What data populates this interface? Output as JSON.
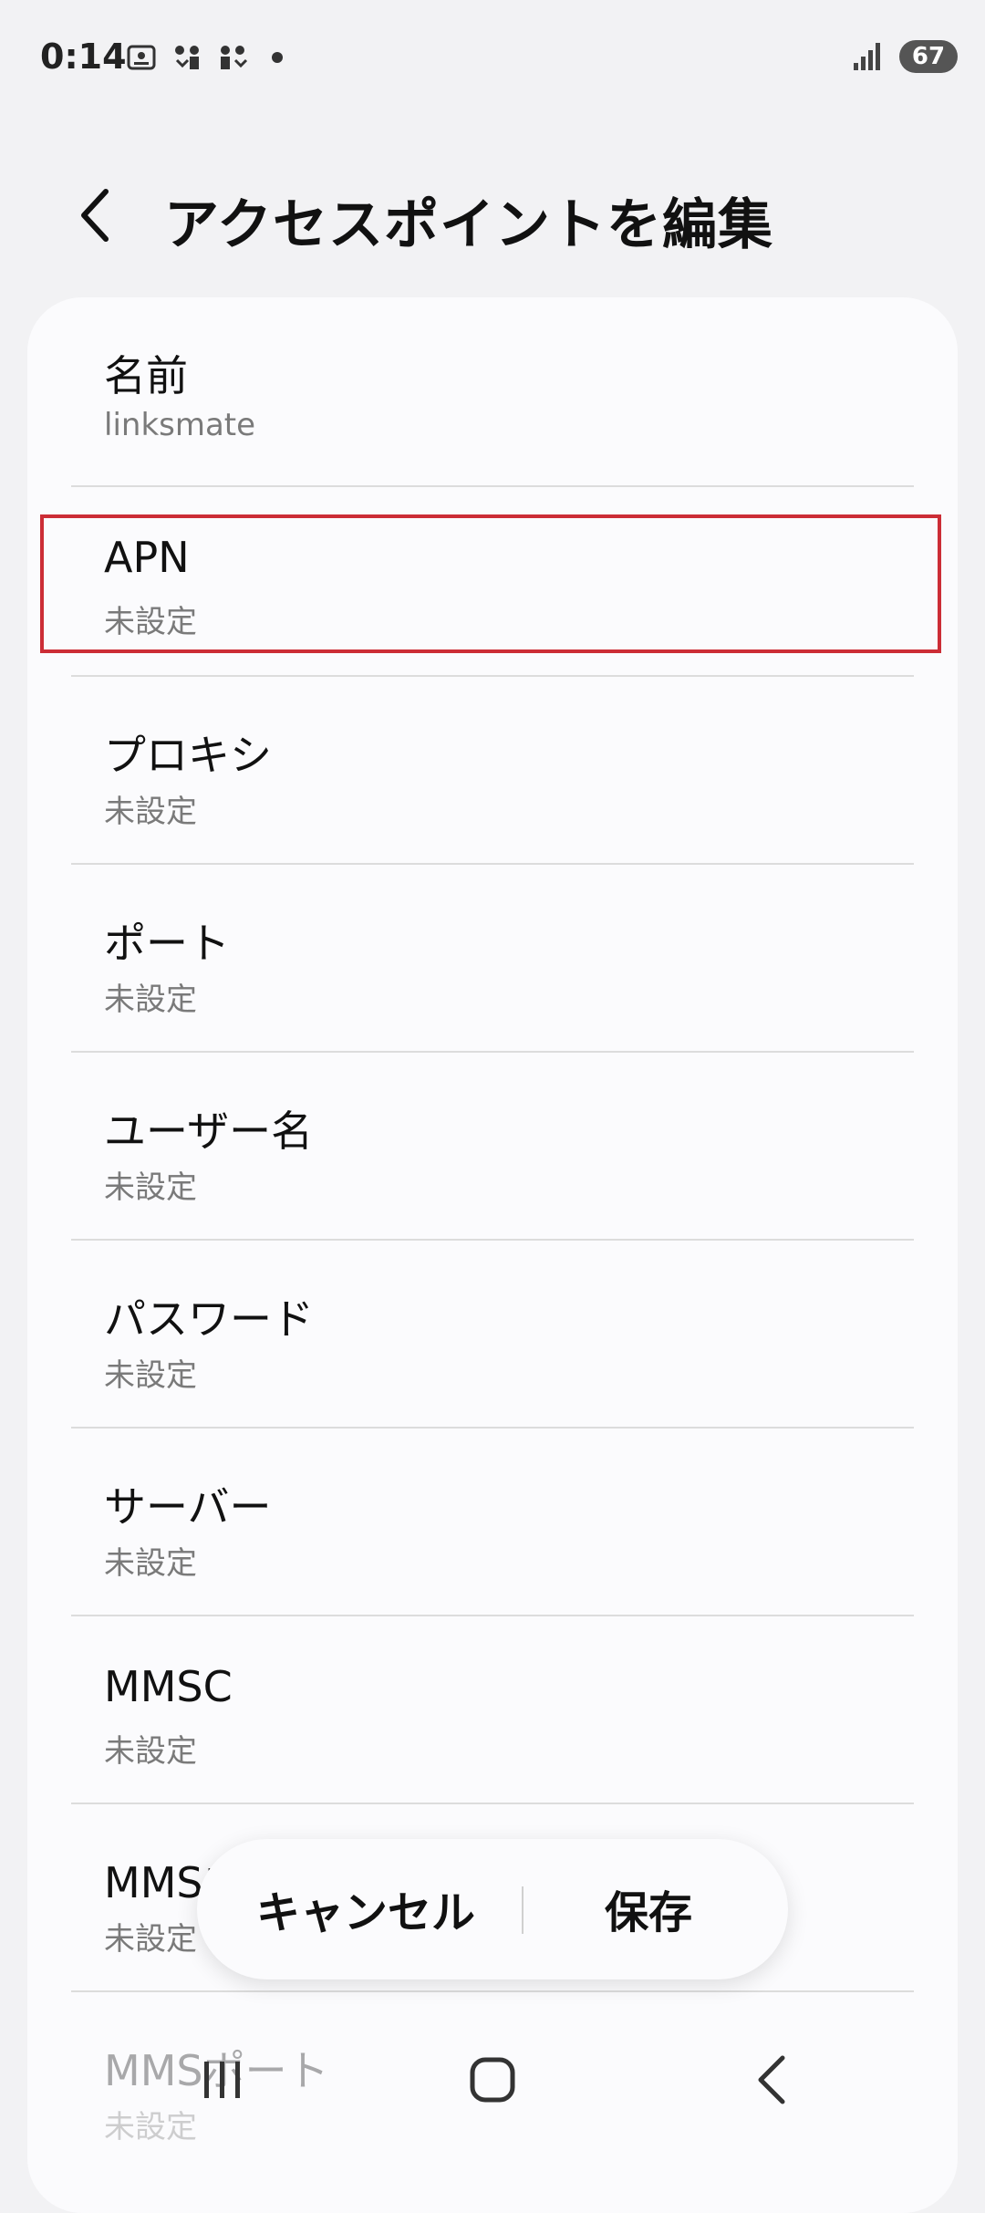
{
  "status_bar": {
    "time": "0:14",
    "battery": "67",
    "icons": [
      "screenshot-icon",
      "download-icon",
      "download-icon",
      "notification-dot-icon",
      "signal-icon",
      "battery-icon"
    ]
  },
  "header": {
    "title": "アクセスポイントを編集",
    "back_icon": "chevron-left-icon"
  },
  "fields": [
    {
      "label": "名前",
      "value": "linksmate"
    },
    {
      "label": "APN",
      "value": "未設定"
    },
    {
      "label": "プロキシ",
      "value": "未設定"
    },
    {
      "label": "ポート",
      "value": "未設定"
    },
    {
      "label": "ユーザー名",
      "value": "未設定"
    },
    {
      "label": "パスワード",
      "value": "未設定"
    },
    {
      "label": "サーバー",
      "value": "未設定"
    },
    {
      "label": "MMSC",
      "value": "未設定"
    },
    {
      "label": "MMSプロキシ",
      "value": "未設定"
    },
    {
      "label": "MMSポート",
      "value": "未設定"
    }
  ],
  "actions": {
    "cancel": "キャンセル",
    "save": "保存"
  },
  "nav": {
    "recents_icon": "recents-icon",
    "home_icon": "home-icon",
    "back_icon": "back-icon"
  },
  "colors": {
    "highlight": "#cc2d36",
    "background": "#f2f2f4",
    "card": "#fbfbfd"
  }
}
